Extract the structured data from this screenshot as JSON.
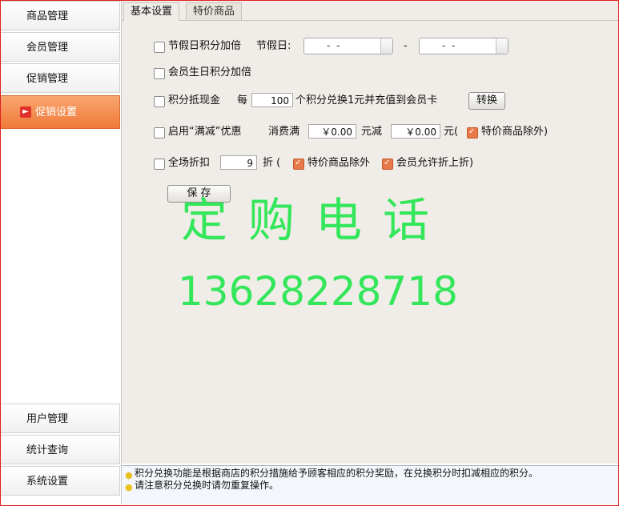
{
  "sidebar": {
    "items": [
      {
        "label": "商品管理"
      },
      {
        "label": "会员管理"
      },
      {
        "label": "促销管理"
      },
      {
        "label": "促销设置"
      },
      {
        "label": "用户管理"
      },
      {
        "label": "统计查询"
      },
      {
        "label": "系统设置"
      }
    ]
  },
  "tabs": [
    {
      "label": "基本设置"
    },
    {
      "label": "特价商品"
    }
  ],
  "form": {
    "holiday_points": {
      "label": "节假日积分加倍",
      "date_label": "节假日:",
      "date_from": "-  -",
      "date_sep": "-",
      "date_to": "-  -"
    },
    "birthday_points": {
      "label": "会员生日积分加倍"
    },
    "points_cash": {
      "label": "积分抵现金",
      "prefix": "每",
      "value": "100",
      "suffix": "个积分兑换1元并充值到会员卡",
      "button": "转换"
    },
    "full_reduce": {
      "label": "启用“满减”优惠",
      "spend_label": "消费满",
      "spend_value": "￥0.00",
      "reduce_label": "元减",
      "reduce_value": "￥0.00",
      "unit": "元(",
      "exclude_label": "特价商品除外)"
    },
    "store_discount": {
      "label": "全场折扣",
      "value": "9",
      "unit": "折 (",
      "exclude_label": "特价商品除外",
      "allow_label": "会员允许折上折)"
    },
    "save_button": "保 存"
  },
  "overlay": {
    "line1": "定购电话",
    "line2": "13628228718"
  },
  "hints": [
    "积分兑换功能是根据商店的积分措施给予顾客相应的积分奖励，在兑换积分时扣减相应的积分。",
    "请注意积分兑换时请勿重复操作。"
  ]
}
